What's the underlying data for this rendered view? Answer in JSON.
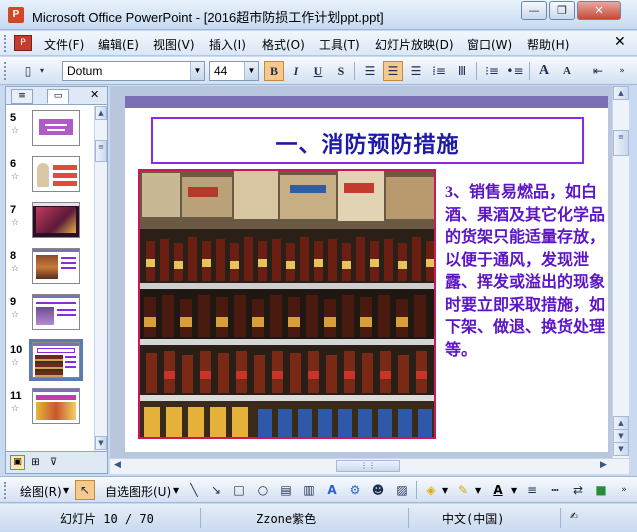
{
  "window": {
    "title": "Microsoft Office PowerPoint - [2016超市防损工作计划ppt.ppt]",
    "buttons": {
      "minimize": "—",
      "restore": "❐",
      "close": "✕"
    }
  },
  "menubar": {
    "items": [
      "文件(F)",
      "编辑(E)",
      "视图(V)",
      "插入(I)",
      "格式(O)",
      "工具(T)",
      "幻灯片放映(D)",
      "窗口(W)",
      "帮助(H)"
    ]
  },
  "format_toolbar": {
    "font_name": "Dotum",
    "font_size": "44",
    "bold": "B",
    "italic": "I",
    "underline": "U",
    "shadow": "S",
    "grow_font": "A",
    "shrink_font": "A"
  },
  "outline_panel": {
    "thumbnails": [
      {
        "num": "5",
        "selected": false
      },
      {
        "num": "6",
        "selected": false
      },
      {
        "num": "7",
        "selected": false
      },
      {
        "num": "8",
        "selected": false
      },
      {
        "num": "9",
        "selected": false
      },
      {
        "num": "10",
        "selected": true
      },
      {
        "num": "11",
        "selected": false
      }
    ]
  },
  "slide": {
    "title": "一、消防预防措施",
    "body": "3、销售易燃品，如白酒、果酒及其它化学品的货架只能适量存放，以便于通风，发现泄露、挥发或溢出的现象时要立即采取措施，如下架、做退、换货处理等。",
    "colors": {
      "title": "#1d1aa6",
      "body": "#5b14c7",
      "frame": "#8a2be2",
      "topbar": "#7b6fb6"
    }
  },
  "draw_toolbar": {
    "draw_label": "绘图(R)",
    "autoshape_label": "自选图形(U)"
  },
  "statusbar": {
    "slide_info": "幻灯片 10 / 70",
    "design": "Zzone紫色",
    "language": "中文(中国)"
  }
}
